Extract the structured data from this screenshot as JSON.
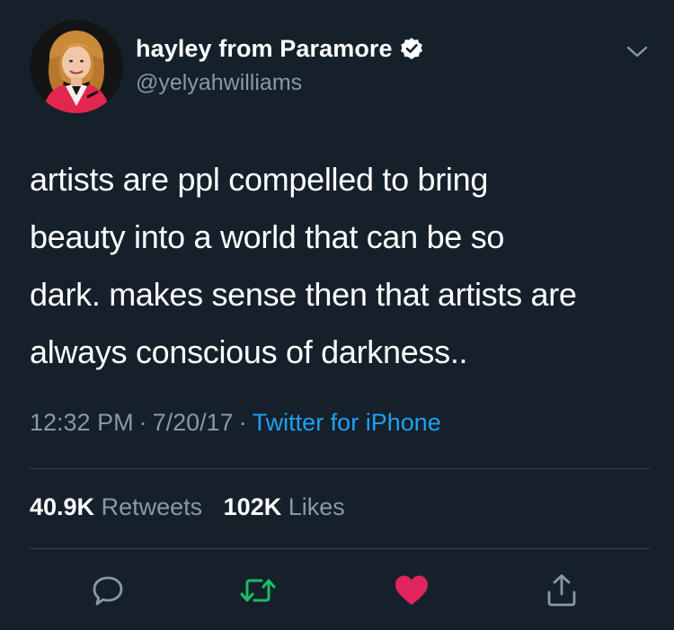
{
  "tweet": {
    "display_name": "hayley from Paramore",
    "handle": "@yelyahwilliams",
    "text_lines": [
      "artists are ppl compelled to bring",
      "beauty into a world that can be so",
      "dark. makes sense then that artists are",
      "always conscious of darkness.."
    ],
    "time": "12:32 PM",
    "date": "7/20/17",
    "separator": "·",
    "source": "Twitter for iPhone",
    "retweets_count": "40.9K",
    "retweets_label": "Retweets",
    "likes_count": "102K",
    "likes_label": "Likes"
  },
  "icons": {
    "verified": "verified-badge-icon",
    "menu": "chevron-down-icon",
    "reply": "reply-bubble-icon",
    "retweet": "retweet-icon",
    "like": "heart-icon",
    "share": "share-icon"
  },
  "colors": {
    "background": "#15202b",
    "text": "#ffffff",
    "muted": "#8899a6",
    "link": "#1da1f2",
    "retweet_active": "#17bf63",
    "like_active": "#e0245e",
    "divider": "#38444d"
  }
}
